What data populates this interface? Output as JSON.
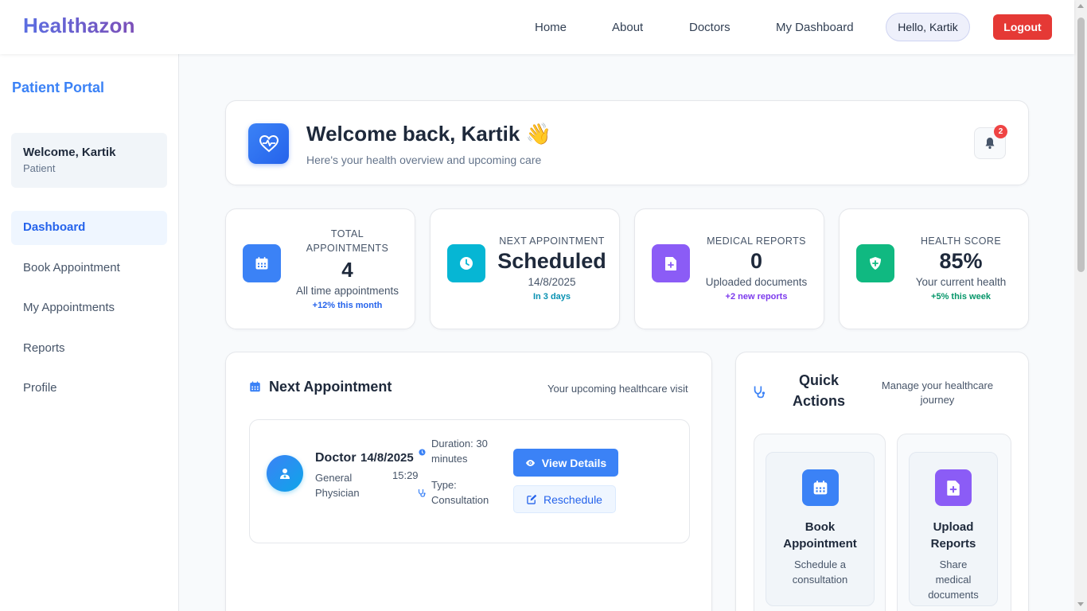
{
  "app": {
    "brand": "Healthazon"
  },
  "nav": {
    "links": [
      "Home",
      "About",
      "Doctors",
      "My Dashboard"
    ],
    "greeting": "Hello, Kartik",
    "logout": "Logout"
  },
  "sidebar": {
    "title": "Patient Portal",
    "welcome_name": "Welcome, Kartik",
    "welcome_role": "Patient",
    "items": [
      {
        "label": "Dashboard",
        "active": true
      },
      {
        "label": "Book Appointment"
      },
      {
        "label": "My Appointments"
      },
      {
        "label": "Reports"
      },
      {
        "label": "Profile"
      }
    ]
  },
  "welcome": {
    "title": "Welcome back, Kartik 👋",
    "subtitle": "Here's your health overview and upcoming care",
    "notifications": "2"
  },
  "stats": [
    {
      "label": "TOTAL APPOINTMENTS",
      "value": "4",
      "desc": "All time appointments",
      "trend": "+12% this month",
      "icon": "calendar-icon",
      "color": "#3b82f6",
      "trend_color": "#2563eb"
    },
    {
      "label": "NEXT APPOINTMENT",
      "value": "Scheduled",
      "desc": "14/8/2025",
      "trend": "In 3 days",
      "icon": "clock-icon",
      "color": "#06b6d4",
      "trend_color": "#0891b2"
    },
    {
      "label": "MEDICAL REPORTS",
      "value": "0",
      "desc": "Uploaded documents",
      "trend": "+2 new reports",
      "icon": "file-plus-icon",
      "color": "#8b5cf6",
      "trend_color": "#7c3aed"
    },
    {
      "label": "HEALTH SCORE",
      "value": "85%",
      "desc": "Your current health",
      "trend": "+5% this week",
      "icon": "shield-plus-icon",
      "color": "#10b981",
      "trend_color": "#059669"
    }
  ],
  "next_appointment": {
    "title": "Next Appointment",
    "subtitle": "Your upcoming healthcare visit",
    "doctor": "Doctor",
    "specialty": "General Physician",
    "date": "14/8/2025",
    "time": "15:29",
    "duration": "Duration: 30 minutes",
    "type": "Type: Consultation",
    "view_label": "View Details",
    "reschedule_label": "Reschedule"
  },
  "quick_actions": {
    "title": "Quick Actions",
    "subtitle": "Manage your healthcare journey",
    "items": [
      {
        "name": "Book Appointment",
        "desc": "Schedule a consultation",
        "icon": "calendar-icon",
        "color": "#3b82f6"
      },
      {
        "name": "Upload Reports",
        "desc": "Share medical documents",
        "icon": "file-plus-icon",
        "color": "#8b5cf6"
      }
    ]
  }
}
